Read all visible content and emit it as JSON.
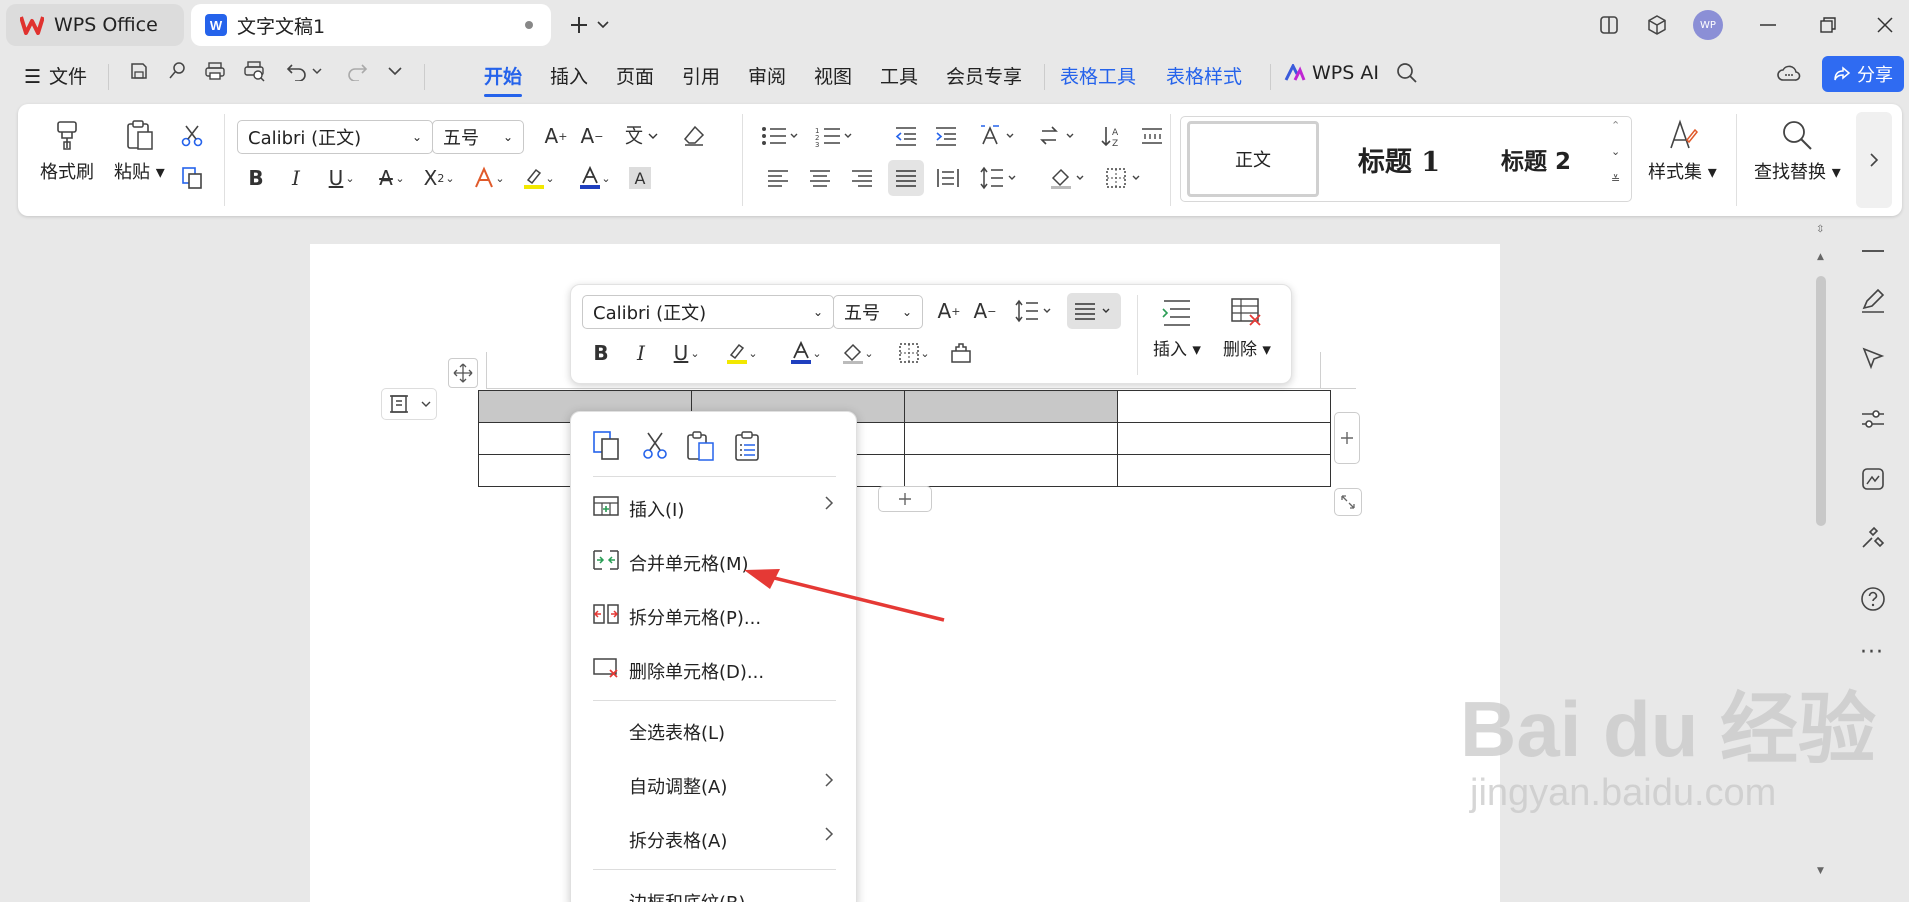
{
  "titlebar": {
    "tabs": [
      {
        "label": "WPS Office"
      },
      {
        "label": "文字文稿1"
      }
    ],
    "avatar": "WP"
  },
  "menubar": {
    "file": "文件",
    "items": [
      "开始",
      "插入",
      "页面",
      "引用",
      "审阅",
      "视图",
      "工具",
      "会员专享"
    ],
    "table_tools": "表格工具",
    "table_style": "表格样式",
    "wps_ai": "WPS AI",
    "share": "分享"
  },
  "ribbon": {
    "format_painter": "格式刷",
    "paste": "粘贴",
    "font": "Calibri (正文)",
    "size": "五号",
    "styles": [
      "正文",
      "标题 1",
      "标题 2"
    ],
    "style_set": "样式集",
    "find_replace": "查找替换"
  },
  "mini_toolbar": {
    "font": "Calibri (正文)",
    "size": "五号",
    "insert": "插入",
    "delete": "删除"
  },
  "context_menu": {
    "items": [
      {
        "label": "插入(I)",
        "submenu": true
      },
      {
        "label": "合并单元格(M)",
        "submenu": false
      },
      {
        "label": "拆分单元格(P)...",
        "submenu": false
      },
      {
        "label": "删除单元格(D)...",
        "submenu": false
      },
      {
        "label": "全选表格(L)",
        "submenu": false
      },
      {
        "label": "自动调整(A)",
        "submenu": true
      },
      {
        "label": "拆分表格(A)",
        "submenu": true
      },
      {
        "label": "边框和底纹(B)...",
        "submenu": false
      }
    ]
  },
  "watermark": {
    "brand": "Bai du 经验",
    "url": "jingyan.baidu.com"
  },
  "colors": {
    "accent": "#2563eb",
    "arrow": "#e53935",
    "wps_red": "#e0322f"
  }
}
